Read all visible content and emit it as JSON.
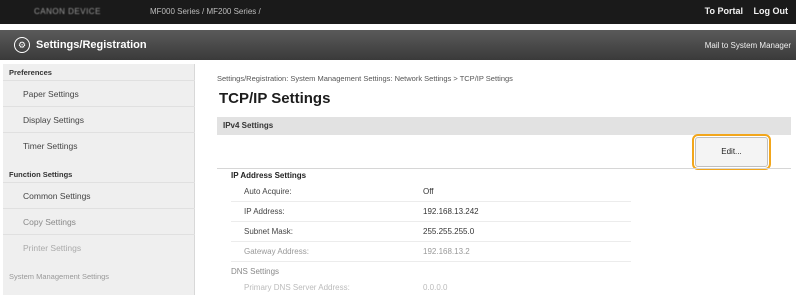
{
  "topbar": {
    "device_name": "CANON DEVICE",
    "model": "MF000 Series / MF200 Series /",
    "portal_link": "To Portal",
    "logout_link": "Log Out"
  },
  "titlebar": {
    "icon": "gear-icon",
    "title": "Settings/Registration",
    "mail_link": "Mail to System Manager"
  },
  "sidebar": {
    "sections": [
      {
        "heading": "Preferences",
        "items": [
          "Paper Settings",
          "Display Settings",
          "Timer Settings"
        ]
      },
      {
        "heading": "Function Settings",
        "items": [
          "Common Settings",
          "Copy Settings",
          "Printer Settings"
        ]
      },
      {
        "heading": "System Management Settings",
        "items": []
      }
    ]
  },
  "main": {
    "breadcrumb": "Settings/Registration: System Management Settings: Network Settings > TCP/IP Settings",
    "title": "TCP/IP Settings",
    "section": "IPv4 Settings",
    "edit_button": "Edit...",
    "ip_group": {
      "heading": "IP Address Settings",
      "rows": [
        {
          "label": "Auto Acquire:",
          "value": "Off"
        },
        {
          "label": "IP Address:",
          "value": "192.168.13.242"
        },
        {
          "label": "Subnet Mask:",
          "value": "255.255.255.0"
        },
        {
          "label": "Gateway Address:",
          "value": "192.168.13.2"
        }
      ]
    },
    "dns_group": {
      "heading": "DNS Settings",
      "rows": [
        {
          "label": "Primary DNS Server Address:",
          "value": "0.0.0.0"
        }
      ]
    }
  },
  "colors": {
    "topbar": "#1a1a1a",
    "titlebar": "#444444",
    "highlight": "#f2a61b",
    "sidebar": "#efefef"
  }
}
